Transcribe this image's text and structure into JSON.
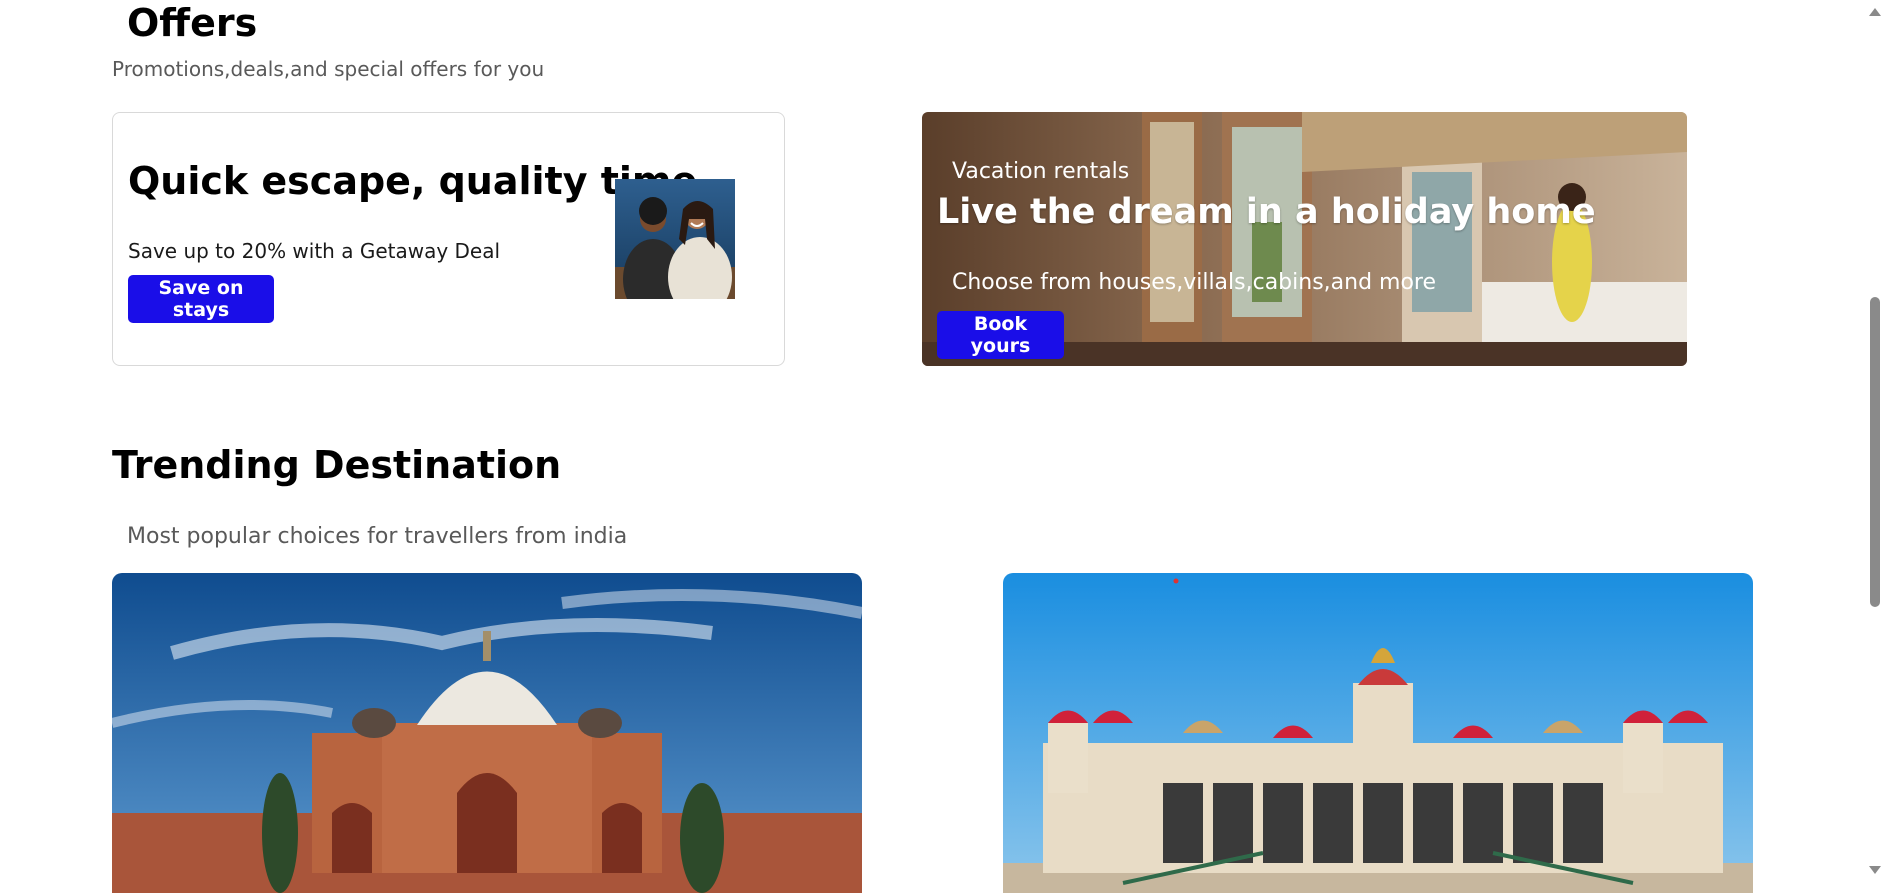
{
  "offers": {
    "title": "Offers",
    "subtitle": "Promotions,deals,and special offers for you",
    "getaway": {
      "headline": "Quick escape, quality time",
      "description": "Save up to 20% with a Getaway Deal",
      "button_label": "Save on stays"
    },
    "rentals": {
      "kicker": "Vacation rentals",
      "headline": "Live the dream in a holiday home",
      "description": "Choose from houses,villals,cabins,and more",
      "button_label": "Book yours"
    }
  },
  "trending": {
    "title": "Trending Destination",
    "subtitle": "Most popular choices for travellers from india"
  },
  "colors": {
    "accent_button": "#1a0ee8",
    "subtitle_text": "#595959"
  }
}
